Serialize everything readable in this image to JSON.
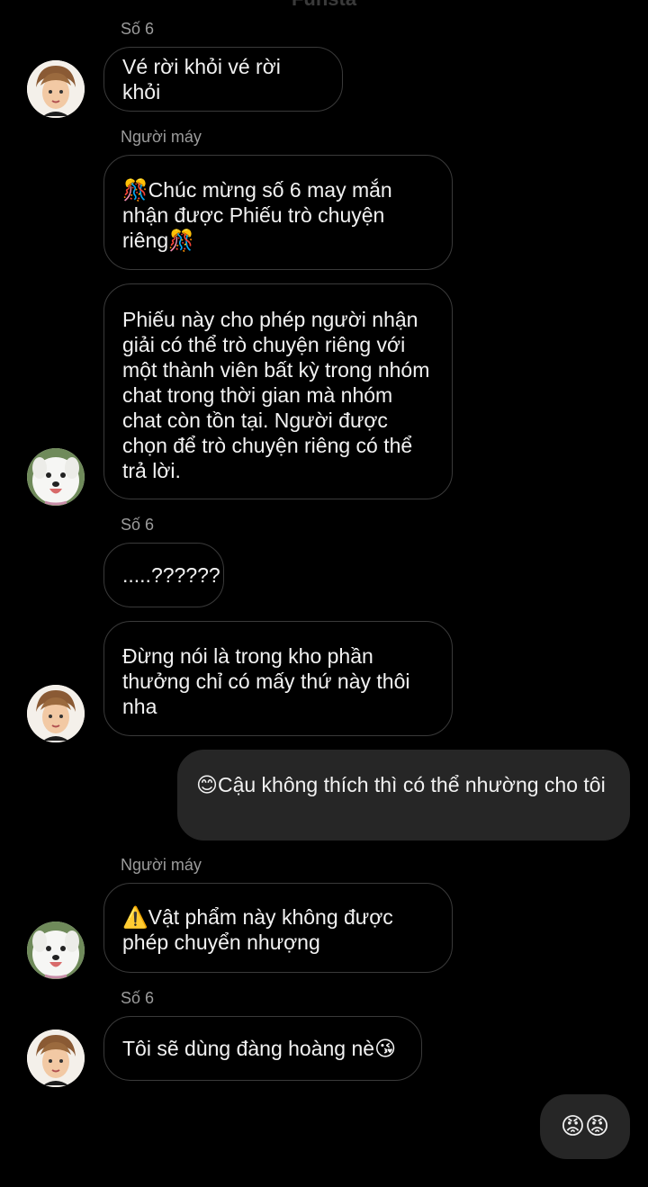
{
  "header": {
    "title": "Funsta"
  },
  "messages": [
    {
      "sender": "Số 6",
      "text": "Vé rời khỏi vé rời khỏi"
    },
    {
      "sender": "Người máy",
      "text": "🎊Chúc mừng số 6 may mắn nhận được Phiếu trò chuyện riêng🎊"
    },
    {
      "text": "Phiếu này cho phép người nhận giải có thể trò chuyện riêng với một thành viên bất kỳ trong nhóm chat trong thời gian mà nhóm chat còn tồn tại. Người được chọn để trò chuyện riêng có thể trả lời."
    },
    {
      "sender": "Số 6",
      "text": ".....??????"
    },
    {
      "text": "Đừng nói là trong kho phần thưởng chỉ có mấy thứ này thôi nha"
    },
    {
      "text": "😊Cậu không thích thì có thể nhường cho tôi"
    },
    {
      "sender": "Người máy",
      "text": "⚠️Vật phẩm này không được phép chuyển nhượng"
    },
    {
      "sender": "Số 6",
      "text": "Tôi sẽ dùng đàng hoàng nè😘"
    },
    {
      "text": "😡😡"
    }
  ],
  "avatars": {
    "boy": "avatar-boy",
    "dog": "avatar-dog"
  },
  "colors": {
    "bg": "#000000",
    "mine_bubble": "#262626",
    "border": "#3a3a3a",
    "sender": "#9c9c9c"
  }
}
